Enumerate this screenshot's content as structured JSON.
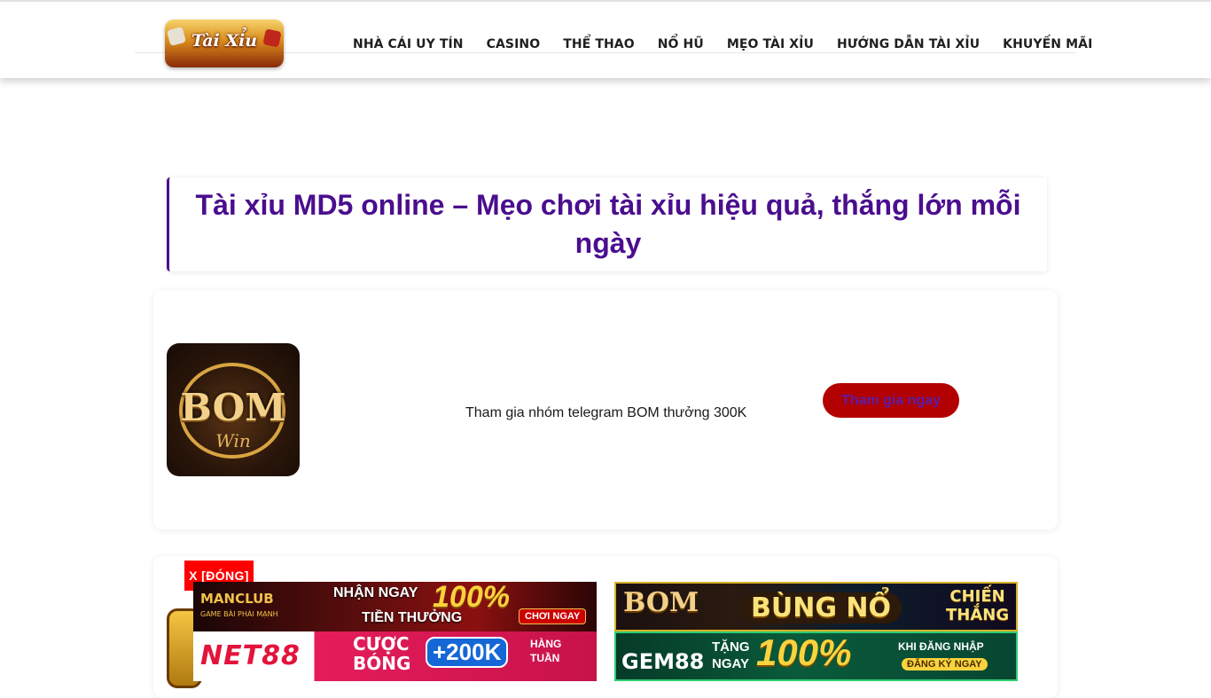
{
  "header": {
    "logo_text": "Tài Xỉu",
    "nav": [
      {
        "label": "NHÀ CÁI UY TÍN"
      },
      {
        "label": "CASINO"
      },
      {
        "label": "THỂ THAO"
      },
      {
        "label": "NỔ HŨ"
      },
      {
        "label": "MẸO TÀI XỈU"
      },
      {
        "label": "HƯỚNG DẪN TÀI XỈU"
      },
      {
        "label": "KHUYẾN MÃI"
      }
    ]
  },
  "article": {
    "title": "Tài xỉu MD5 online – Mẹo chơi tài xỉu hiệu quả, thắng lớn mỗi ngày"
  },
  "promo": {
    "logo_text": "BOM",
    "logo_sub": "Win",
    "text": "Tham gia nhóm telegram BOM thưởng 300K",
    "button_label": "Tham gia ngay"
  },
  "ads": {
    "close_label": "X [ĐÓNG]",
    "manclub": {
      "brand": "MANCLUB",
      "sub": "GAME BÀI PHÁI MẠNH",
      "main": "NHẬN NGAY",
      "pct": "100%",
      "main2": "TIỀN THƯỞNG",
      "cta": "CHƠI NGAY"
    },
    "net88": {
      "brand": "NET88",
      "main1": "CƯỢC",
      "main2": "BÓNG",
      "badge": "+200K",
      "side1": "HÀNG",
      "side2": "TUẦN"
    },
    "bom": {
      "brand": "BOM",
      "main": "BÙNG NỔ",
      "win1": "CHIẾN",
      "win2": "THẮNG"
    },
    "gem88": {
      "brand": "GEM88",
      "main1": "TẶNG",
      "main2": "NGAY",
      "pct": "100%",
      "side": "KHI ĐĂNG NHẬP",
      "cta": "ĐĂNG KÝ NGAY"
    }
  },
  "colors": {
    "title": "#4a0e8e",
    "button_bg": "#b30000",
    "close_bg": "#ff0000"
  }
}
